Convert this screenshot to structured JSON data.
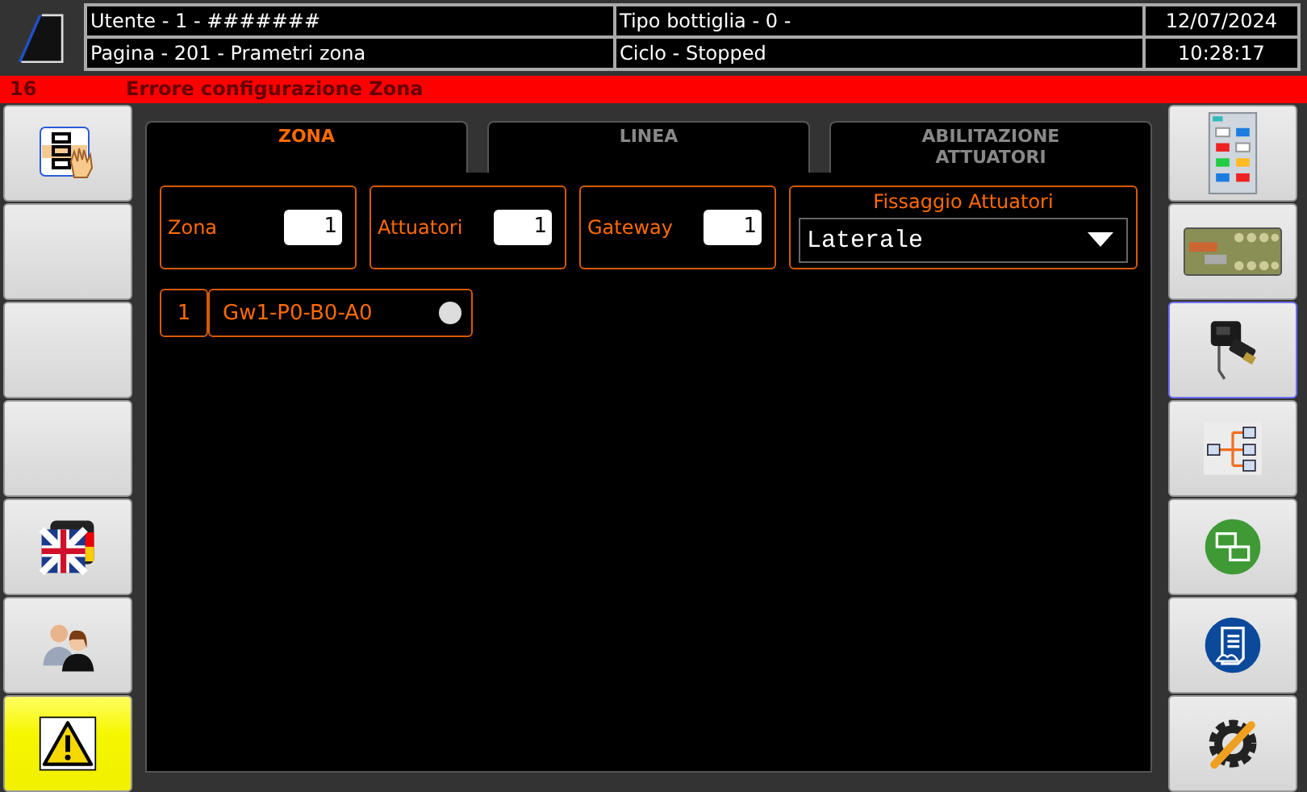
{
  "header": {
    "user": "Utente - 1 - #######",
    "bottle": "Tipo bottiglia - 0 -",
    "date": "12/07/2024",
    "page": "Pagina - 201 - Prametri zona",
    "cycle": "Ciclo - Stopped",
    "time": "10:28:17"
  },
  "alarm": {
    "code": "16",
    "message": "Errore configurazione Zona"
  },
  "left_buttons": [
    {
      "kind": "tree-hand",
      "active": false
    },
    {
      "kind": "blank",
      "active": false
    },
    {
      "kind": "blank",
      "active": false
    },
    {
      "kind": "blank",
      "active": false
    },
    {
      "kind": "flag",
      "active": false
    },
    {
      "kind": "people",
      "active": false
    },
    {
      "kind": "warning",
      "active": true
    }
  ],
  "tabs": [
    {
      "label": "ZONA",
      "selected": true
    },
    {
      "label": "LINEA",
      "selected": false
    },
    {
      "label": "ABILITAZIONE ATTUATORI",
      "selected": false
    }
  ],
  "fields": [
    {
      "label": "Zona",
      "value": "1"
    },
    {
      "label": "Attuatori",
      "value": "1"
    },
    {
      "label": "Gateway",
      "value": "1"
    }
  ],
  "fixing": {
    "title": "Fissaggio Attuatori",
    "value": "Laterale"
  },
  "gateways": [
    {
      "index": "1",
      "name": "Gw1-P0-B0-A0",
      "on": false
    }
  ],
  "right_buttons": [
    {
      "kind": "panel",
      "selected": false
    },
    {
      "kind": "board",
      "selected": false
    },
    {
      "kind": "device",
      "selected": true
    },
    {
      "kind": "tree",
      "selected": false
    },
    {
      "kind": "network",
      "selected": false
    },
    {
      "kind": "document",
      "selected": false
    },
    {
      "kind": "gear",
      "selected": false
    }
  ]
}
